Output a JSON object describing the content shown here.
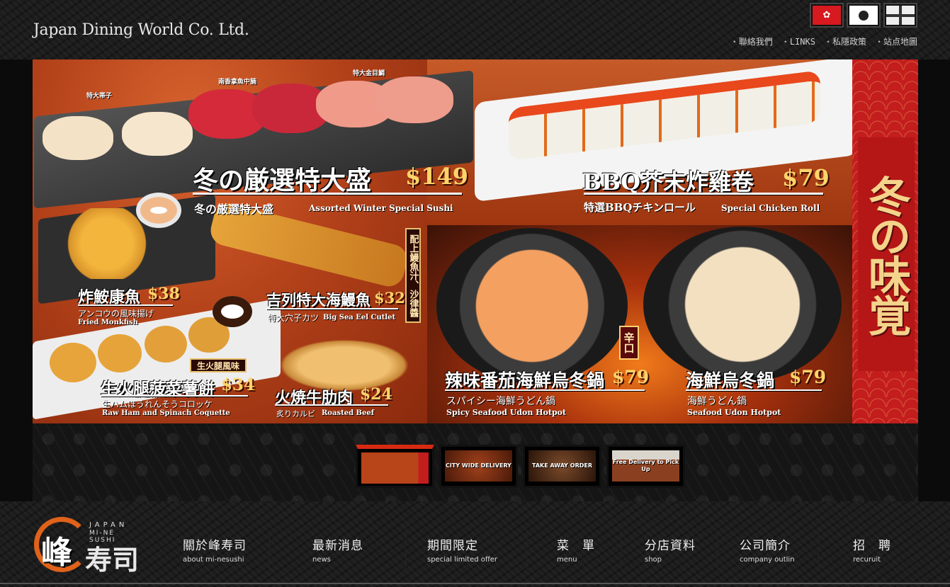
{
  "header": {
    "company": "Japan Dining World Co. Ltd.",
    "flags": [
      {
        "name": "hong-kong-flag-icon",
        "glyph": "✿"
      },
      {
        "name": "japan-flag-icon"
      },
      {
        "name": "uk-flag-icon"
      }
    ],
    "links": [
      "聯絡我們",
      "LINKS",
      "私隱政策",
      "站点地圖"
    ]
  },
  "banner": {
    "vertical_title": "冬の味覚",
    "plate_tags": [
      "特大帯子",
      "南香拿魚中腩",
      "特大金目鯛"
    ],
    "items": {
      "winter_sushi": {
        "name": "冬の厳選特大盛",
        "price": "$149",
        "jp": "冬の厳選特大盛",
        "en": "Assorted Winter Special Sushi"
      },
      "bbq_roll": {
        "name": "BBQ芥末炸雞卷",
        "price": "$79",
        "jp": "特選BBQチキンロール",
        "en": "Special Chicken Roll"
      },
      "monkfish": {
        "name": "炸鮟康魚",
        "price": "$38",
        "jp": "アンコウの風味揚げ",
        "en": "Fried Monkfish"
      },
      "eel": {
        "name": "吉列特大海鰻魚",
        "price": "$32",
        "jp": "特大穴子カツ",
        "en": "Big Sea Eel Cutlet"
      },
      "coquette": {
        "name": "生火腿菠菜薯餅",
        "price": "$34",
        "jp": "生ハムほうれんそうコロッケ",
        "en": "Raw Ham and Spinach Coquette",
        "badge": "生火腿風味"
      },
      "beef": {
        "name": "火焼牛肋肉",
        "price": "$24",
        "jp": "炙りカルビ",
        "en": "Roasted Beef"
      },
      "spicy_udon": {
        "name": "辣味番茄海鮮烏冬鍋",
        "price": "$79",
        "jp": "スパイシー海鮮うどん鍋",
        "en": "Spicy Seafood Udon Hotpot",
        "badge": "辛口"
      },
      "seafood_udon": {
        "name": "海鮮烏冬鍋",
        "price": "$79",
        "jp": "海鮮うどん鍋",
        "en": "Seafood Udon Hotpot"
      }
    },
    "sauce_note": "配上鰻魚汁、沙律醬"
  },
  "thumbnails": [
    {
      "label": "",
      "active": true,
      "color": "#b8441a"
    },
    {
      "label": "CITY WIDE DELIVERY",
      "active": false,
      "color": "#7a2a12"
    },
    {
      "label": "TAKE AWAY ORDER",
      "active": false,
      "color": "#4a2a1a"
    },
    {
      "label": "Free Delivery to Pick Up",
      "active": false,
      "color": "#5a3020"
    }
  ],
  "footer": {
    "logo": {
      "main": "峰",
      "sub": "寿司",
      "en_top": "JAPAN",
      "en": "MI-NE SUSHI"
    },
    "nav": [
      {
        "cn": "關於峰寿司",
        "en": "about mi-nesushi"
      },
      {
        "cn": "最新消息",
        "en": "news"
      },
      {
        "cn": "期間限定",
        "en": "special limited offer"
      },
      {
        "cn": "菜　單",
        "en": "menu"
      },
      {
        "cn": "分店資料",
        "en": "shop"
      },
      {
        "cn": "公司簡介",
        "en": "company outlin"
      },
      {
        "cn": "招　聘",
        "en": "recuruit"
      }
    ]
  },
  "colors": {
    "accent": "#d72a10",
    "price": "#ffd36b",
    "brand_orange": "#e0621a"
  }
}
